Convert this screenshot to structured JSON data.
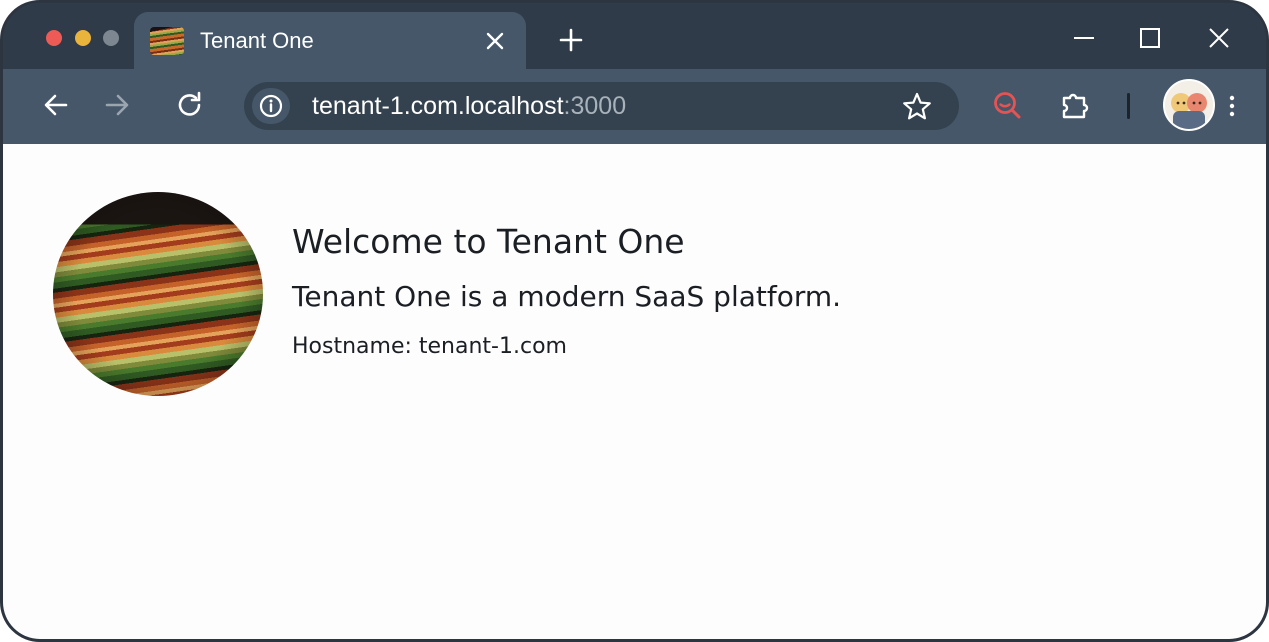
{
  "browser": {
    "tab": {
      "title": "Tenant One"
    },
    "address_bar": {
      "host": "tenant-1.com.localhost",
      "port": ":3000"
    },
    "icons": {
      "traffic_lights": [
        "close-dot",
        "minimize-dot",
        "zoom-dot"
      ],
      "toolbar": [
        "back-arrow-icon",
        "forward-arrow-icon",
        "reload-icon",
        "site-info-icon",
        "bookmark-star-icon",
        "search-lens-icon",
        "extensions-puzzle-icon",
        "profile-avatar",
        "menu-kebab-icon"
      ],
      "window": [
        "minimize-icon",
        "maximize-icon",
        "close-icon"
      ]
    },
    "colors": {
      "tab_strip": "#2f3b48",
      "toolbar": "#46576a",
      "omnibox": "#34424f",
      "search_icon": "#e55353"
    }
  },
  "page": {
    "heading": "Welcome to Tenant One",
    "description": "Tenant One is a modern SaaS platform.",
    "hostname_line": "Hostname: tenant-1.com"
  }
}
